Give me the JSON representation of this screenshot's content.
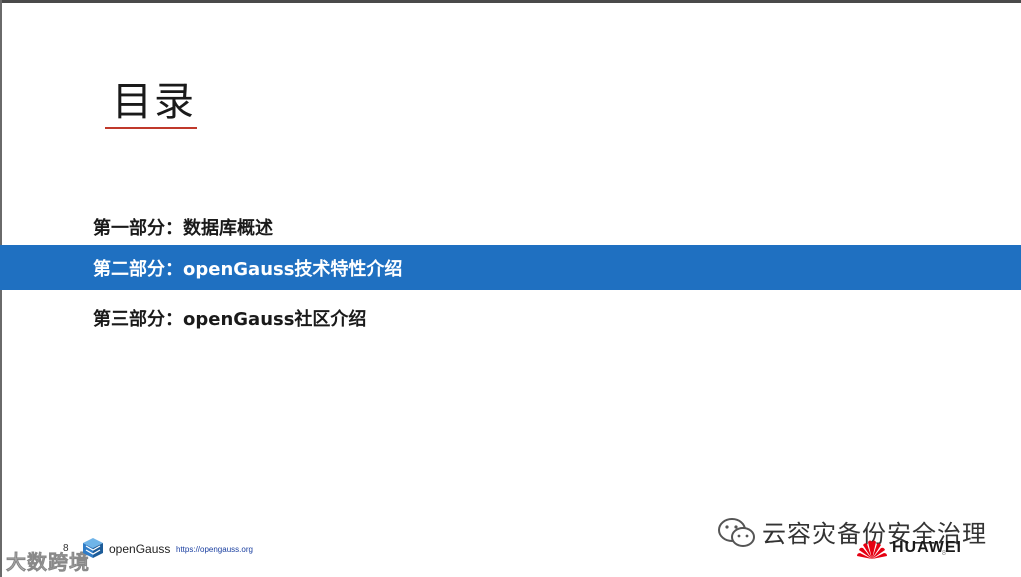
{
  "slide": {
    "title": "目录",
    "toc": [
      {
        "label": "第一部分：数据库概述",
        "active": false
      },
      {
        "label": "第二部分：openGauss技术特性介绍",
        "active": true
      },
      {
        "label": "第三部分：openGauss社区介绍",
        "active": false
      }
    ]
  },
  "footer": {
    "page_number": "8",
    "logo_text": "openGauss",
    "url": "https://opengauss.org",
    "brand": "HUAWEI",
    "corner_number": "8"
  },
  "watermarks": {
    "left": "大数跨境",
    "right": "云容灾备份安全治理"
  },
  "colors": {
    "active_row": "#1f70c1",
    "underline": "#c0392b",
    "huawei_red": "#e60012"
  },
  "icons": [
    "opengauss-logo-icon",
    "wechat-icon",
    "huawei-logo-icon"
  ]
}
